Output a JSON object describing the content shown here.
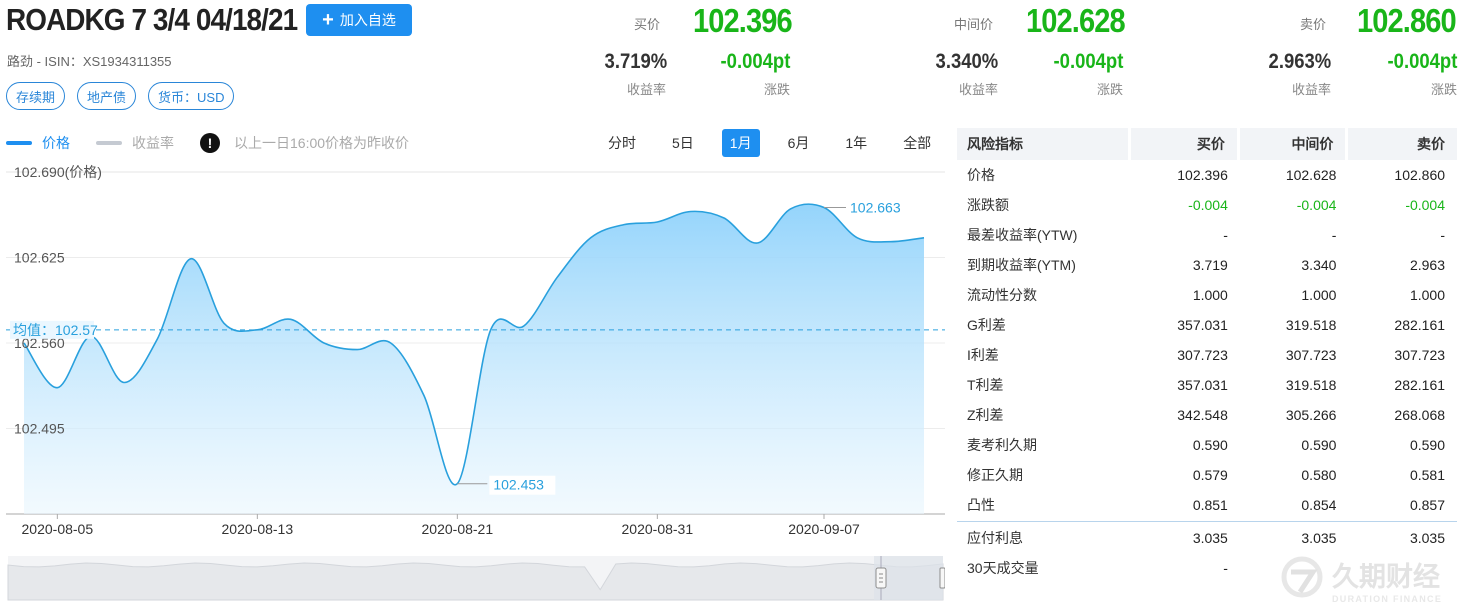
{
  "header": {
    "title": "ROADKG 7 3/4 04/18/21",
    "watch_label": "加入自选",
    "subline": "路劲 - ISIN：XS1934311355",
    "tags": [
      "存续期",
      "地产债",
      "货币：USD"
    ]
  },
  "quotes": [
    {
      "label": "买价",
      "price": "102.396",
      "yield": "3.719%",
      "yield_label": "收益率",
      "change": "-0.004pt",
      "change_label": "涨跌"
    },
    {
      "label": "中间价",
      "price": "102.628",
      "yield": "3.340%",
      "yield_label": "收益率",
      "change": "-0.004pt",
      "change_label": "涨跌"
    },
    {
      "label": "卖价",
      "price": "102.860",
      "yield": "2.963%",
      "yield_label": "收益率",
      "change": "-0.004pt",
      "change_label": "涨跌"
    }
  ],
  "legend": {
    "price": "价格",
    "yield": "收益率",
    "note": "以上一日16:00价格为昨收价"
  },
  "ranges": {
    "items": [
      "分时",
      "5日",
      "1月",
      "6月",
      "1年",
      "全部"
    ],
    "active": "1月"
  },
  "chart_data": {
    "type": "area",
    "series": [
      {
        "name": "价格",
        "color": "#29a0dd"
      }
    ],
    "x": [
      "2020-08-04",
      "2020-08-05",
      "2020-08-06",
      "2020-08-07",
      "2020-08-10",
      "2020-08-11",
      "2020-08-12",
      "2020-08-13",
      "2020-08-14",
      "2020-08-17",
      "2020-08-18",
      "2020-08-19",
      "2020-08-20",
      "2020-08-21",
      "2020-08-24",
      "2020-08-25",
      "2020-08-26",
      "2020-08-27",
      "2020-08-28",
      "2020-08-31",
      "2020-09-01",
      "2020-09-02",
      "2020-09-03",
      "2020-09-04",
      "2020-09-07",
      "2020-09-08",
      "2020-09-09",
      "2020-09-10"
    ],
    "y": [
      102.56,
      102.526,
      102.565,
      102.53,
      102.563,
      102.624,
      102.575,
      102.57,
      102.578,
      102.56,
      102.555,
      102.56,
      102.52,
      102.453,
      102.57,
      102.573,
      102.61,
      102.64,
      102.65,
      102.652,
      102.66,
      102.655,
      102.636,
      102.662,
      102.663,
      102.64,
      102.637,
      102.64
    ],
    "ylabel": "价格",
    "y_ticks": [
      "102.690(价格)",
      "102.625",
      "102.560",
      "102.495"
    ],
    "y_tick_values": [
      102.69,
      102.625,
      102.56,
      102.495
    ],
    "x_ticks": [
      "2020-08-05",
      "2020-08-13",
      "2020-08-21",
      "2020-08-31",
      "2020-09-07"
    ],
    "mean_label": "均值：102.57",
    "mean": 102.57,
    "max_label": "102.663",
    "min_label": "102.453",
    "ylim": [
      102.43,
      102.69
    ]
  },
  "risk_table": {
    "headers": [
      "风险指标",
      "买价",
      "中间价",
      "卖价"
    ],
    "rows": [
      {
        "name": "价格",
        "values": [
          "102.396",
          "102.628",
          "102.860"
        ]
      },
      {
        "name": "涨跌额",
        "values": [
          "-0.004",
          "-0.004",
          "-0.004"
        ],
        "negative": true
      },
      {
        "name": "最差收益率(YTW)",
        "values": [
          "-",
          "-",
          "-"
        ]
      },
      {
        "name": "到期收益率(YTM)",
        "values": [
          "3.719",
          "3.340",
          "2.963"
        ]
      },
      {
        "name": "流动性分数",
        "values": [
          "1.000",
          "1.000",
          "1.000"
        ]
      },
      {
        "name": "G利差",
        "values": [
          "357.031",
          "319.518",
          "282.161"
        ]
      },
      {
        "name": "I利差",
        "values": [
          "307.723",
          "307.723",
          "307.723"
        ]
      },
      {
        "name": "T利差",
        "values": [
          "357.031",
          "319.518",
          "282.161"
        ]
      },
      {
        "name": "Z利差",
        "values": [
          "342.548",
          "305.266",
          "268.068"
        ]
      },
      {
        "name": "麦考利久期",
        "values": [
          "0.590",
          "0.590",
          "0.590"
        ]
      },
      {
        "name": "修正久期",
        "values": [
          "0.579",
          "0.580",
          "0.581"
        ]
      },
      {
        "name": "凸性",
        "values": [
          "0.851",
          "0.854",
          "0.857"
        ]
      }
    ],
    "extra_rows": [
      {
        "name": "应付利息",
        "values": [
          "3.035",
          "3.035",
          "3.035"
        ]
      },
      {
        "name": "30天成交量",
        "values": [
          "-",
          "",
          ""
        ]
      }
    ]
  },
  "watermark": {
    "name": "久期财经",
    "en": "DURATION FINANCE"
  },
  "colors": {
    "accent": "#1e8ff0",
    "down": "#19b519",
    "line": "#29a0dd"
  }
}
